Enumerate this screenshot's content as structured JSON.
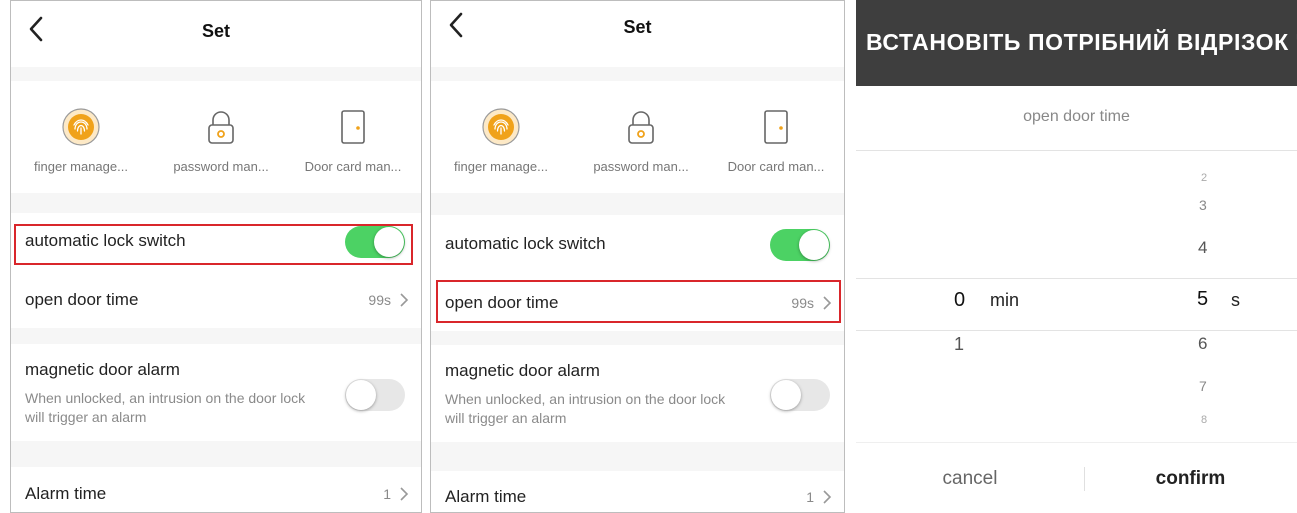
{
  "settings": {
    "title": "Set",
    "shortcuts": [
      {
        "label": "finger manage...",
        "icon": "fingerprint-icon"
      },
      {
        "label": "password man...",
        "icon": "lock-icon"
      },
      {
        "label": "Door card man...",
        "icon": "door-icon"
      }
    ],
    "auto_lock": {
      "label": "automatic lock switch",
      "enabled": true
    },
    "open_door_time": {
      "label": "open door time",
      "value": "99s"
    },
    "magnetic_alarm": {
      "label": "magnetic door alarm",
      "description": "When unlocked, an intrusion on the door lock will trigger an alarm",
      "enabled": false
    },
    "alarm_time": {
      "label": "Alarm time",
      "value": "1"
    }
  },
  "picker": {
    "header": "ВСТАНОВІТЬ ПОТРІБНИЙ ВІДРІЗОК ЧАСУ",
    "title": "open door time",
    "minutes": [
      "0",
      "1"
    ],
    "minutes_selected": "0",
    "minutes_unit": "min",
    "seconds": [
      "2",
      "3",
      "4",
      "5",
      "6",
      "7",
      "8"
    ],
    "seconds_selected": "5",
    "seconds_unit": "s",
    "cancel_label": "cancel",
    "confirm_label": "confirm"
  },
  "colors": {
    "toggle_on": "#4cd264",
    "toggle_off": "#e7e7e7",
    "highlight": "#d9262b",
    "fingerprint": "#f0a21a",
    "icon_accent": "#f0a21a",
    "picker_header": "#3e3e3e"
  }
}
